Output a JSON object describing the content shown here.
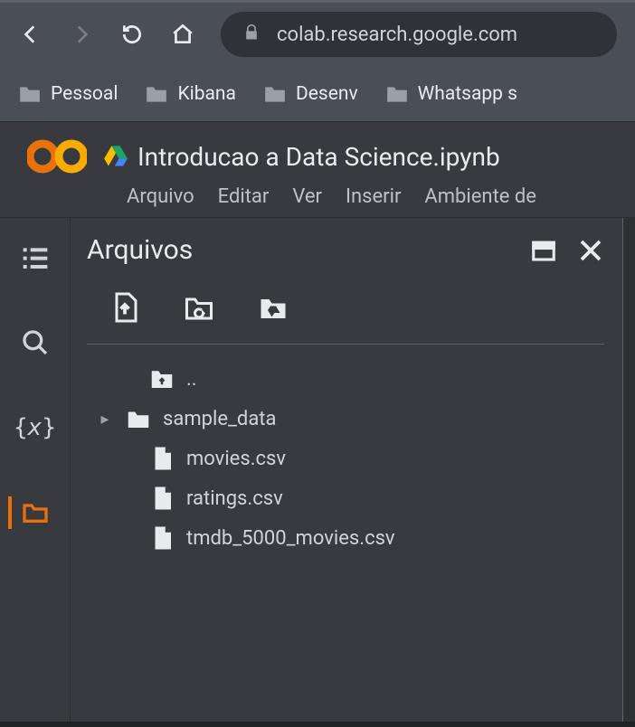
{
  "browser": {
    "url": "colab.research.google.com"
  },
  "bookmarks": [
    {
      "label": "Pessoal"
    },
    {
      "label": "Kibana"
    },
    {
      "label": "Desenv"
    },
    {
      "label": "Whatsapp s"
    }
  ],
  "notebook": {
    "title": "Introducao a Data Science.ipynb"
  },
  "menu": {
    "arquivo": "Arquivo",
    "editar": "Editar",
    "ver": "Ver",
    "inserir": "Inserir",
    "ambiente": "Ambiente de"
  },
  "panel": {
    "title": "Arquivos"
  },
  "files": {
    "parent": "..",
    "sample_data": "sample_data",
    "movies": "movies.csv",
    "ratings": "ratings.csv",
    "tmdb": "tmdb_5000_movies.csv"
  }
}
